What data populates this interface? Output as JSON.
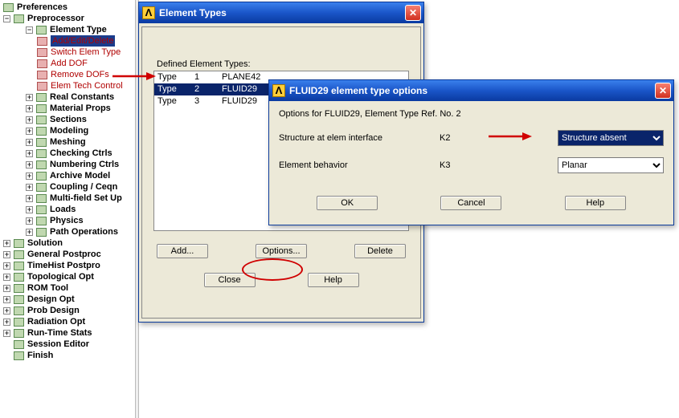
{
  "tree": {
    "preferences": "Preferences",
    "preprocessor": "Preprocessor",
    "element_type": "Element Type",
    "et_children": {
      "add_edit_delete": "Add/Edit/Delete",
      "switch_elem_type": "Switch Elem Type",
      "add_dof": "Add DOF",
      "remove_dofs": "Remove DOFs",
      "elem_tech_control": "Elem Tech Control"
    },
    "items": [
      "Real Constants",
      "Material Props",
      "Sections",
      "Modeling",
      "Meshing",
      "Checking Ctrls",
      "Numbering Ctrls",
      "Archive Model",
      "Coupling / Ceqn",
      "Multi-field Set Up",
      "Loads",
      "Physics",
      "Path Operations"
    ],
    "top_items": [
      "Solution",
      "General Postproc",
      "TimeHist Postpro",
      "Topological Opt",
      "ROM Tool",
      "Design Opt",
      "Prob Design",
      "Radiation Opt",
      "Run-Time Stats",
      "Session Editor",
      "Finish"
    ]
  },
  "et_dialog": {
    "title": "Element Types",
    "defined_label": "Defined Element Types:",
    "rows": [
      {
        "a": "Type",
        "b": "1",
        "c": "PLANE42"
      },
      {
        "a": "Type",
        "b": "2",
        "c": "FLUID29"
      },
      {
        "a": "Type",
        "b": "3",
        "c": "FLUID29"
      }
    ],
    "selected_index": 1,
    "btn_add": "Add...",
    "btn_options": "Options...",
    "btn_delete": "Delete",
    "btn_close": "Close",
    "btn_help": "Help"
  },
  "opt_dialog": {
    "title": "FLUID29 element type options",
    "header": "Options for FLUID29, Element Type Ref. No. 2",
    "row1_label": "Structure at elem interface",
    "row1_key": "K2",
    "row1_value": "Structure absent",
    "row2_label": "Element behavior",
    "row2_key": "K3",
    "row2_value": "Planar",
    "btn_ok": "OK",
    "btn_cancel": "Cancel",
    "btn_help": "Help"
  }
}
